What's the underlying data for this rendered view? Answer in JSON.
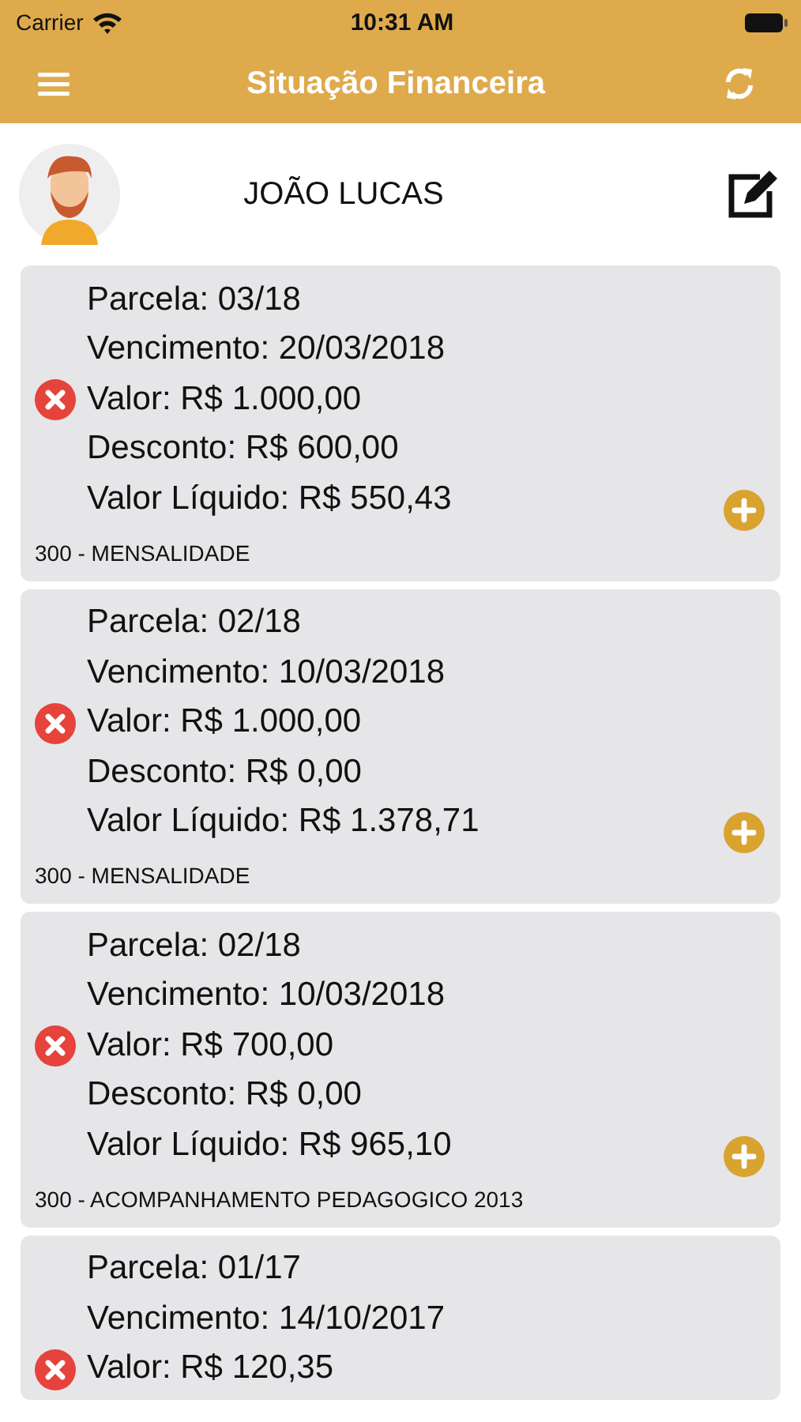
{
  "status_bar": {
    "carrier": "Carrier",
    "time": "10:31 AM"
  },
  "header": {
    "title": "Situação Financeira"
  },
  "profile": {
    "name": "JOÃO LUCAS"
  },
  "installments": [
    {
      "kind": "overdue",
      "lines": [
        "Parcela: 03/18",
        "Vencimento: 20/03/2018",
        "Valor: R$ 1.000,00",
        "Desconto: R$ 600,00",
        "Valor Líquido: R$ 550,43"
      ],
      "footer": "300 - MENSALIDADE"
    },
    {
      "kind": "overdue",
      "lines": [
        "Parcela: 02/18",
        "Vencimento: 10/03/2018",
        "Valor: R$ 1.000,00",
        "Desconto: R$ 0,00",
        "Valor Líquido: R$ 1.378,71"
      ],
      "footer": "300 - MENSALIDADE"
    },
    {
      "kind": "overdue",
      "lines": [
        "Parcela: 02/18",
        "Vencimento: 10/03/2018",
        "Valor: R$ 700,00",
        "Desconto: R$ 0,00",
        "Valor Líquido: R$ 965,10"
      ],
      "footer": "300 - ACOMPANHAMENTO PEDAGOGICO 2013"
    },
    {
      "kind": "overdue",
      "lines": [
        "Parcela: 01/17",
        "Vencimento: 14/10/2017",
        "Valor: R$ 120,35"
      ]
    }
  ]
}
